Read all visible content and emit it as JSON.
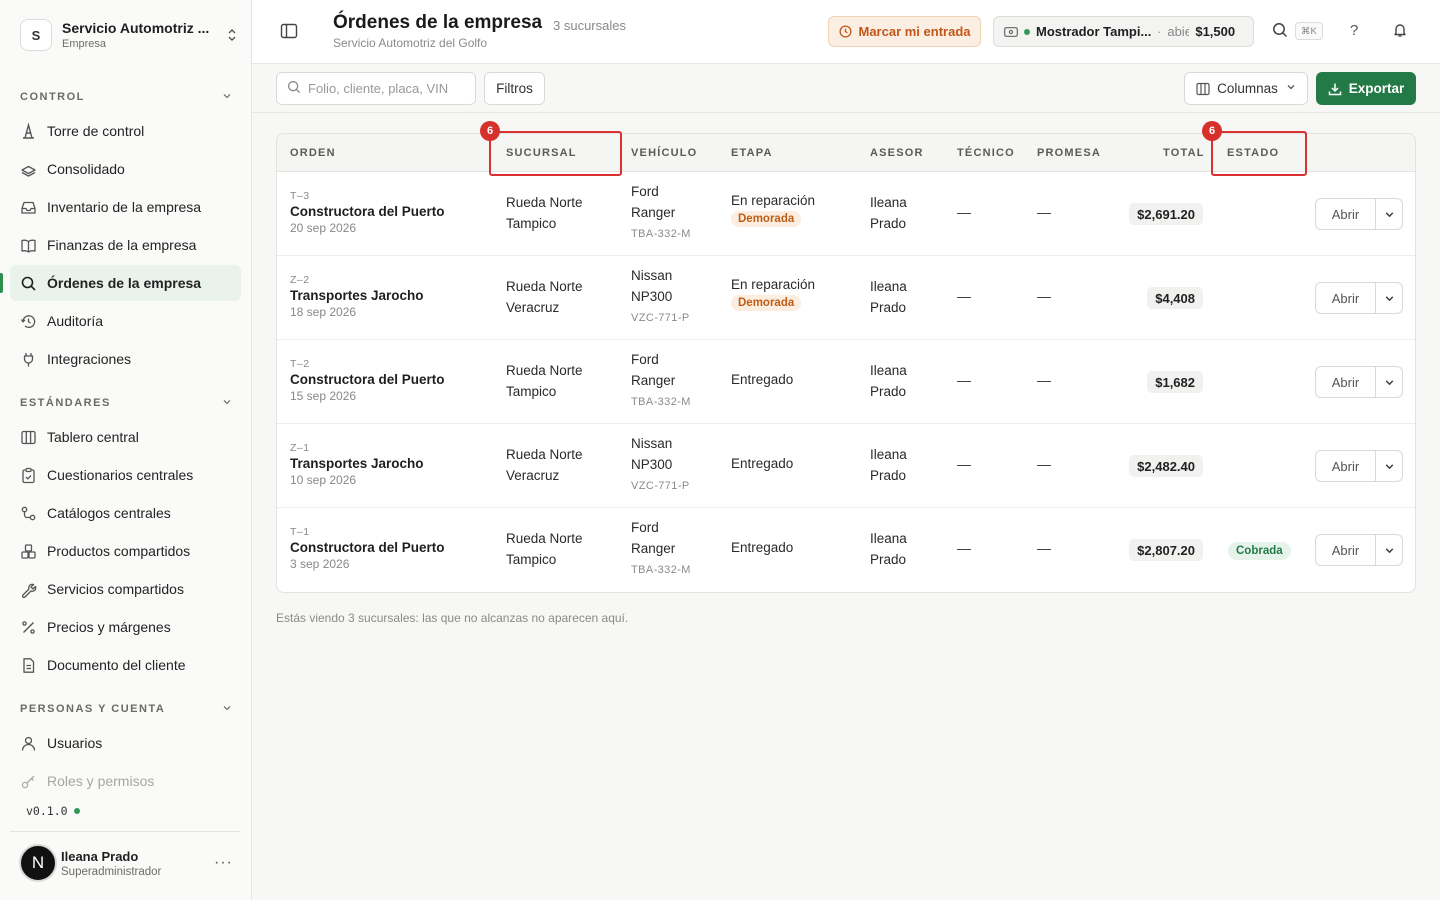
{
  "org": {
    "initial": "S",
    "name": "Servicio Automotriz ...",
    "type": "Empresa"
  },
  "sections": {
    "control": "CONTROL",
    "estandares": "ESTÁNDARES",
    "personas": "PERSONAS Y CUENTA"
  },
  "nav": {
    "control": [
      {
        "label": "Torre de control",
        "icon": "tower-icon"
      },
      {
        "label": "Consolidado",
        "icon": "stack-icon"
      },
      {
        "label": "Inventario de la empresa",
        "icon": "inbox-icon"
      },
      {
        "label": "Finanzas de la empresa",
        "icon": "book-icon"
      },
      {
        "label": "Órdenes de la empresa",
        "icon": "search-icon",
        "active": true
      },
      {
        "label": "Auditoría",
        "icon": "history-icon"
      },
      {
        "label": "Integraciones",
        "icon": "plug-icon"
      }
    ],
    "estandares": [
      {
        "label": "Tablero central",
        "icon": "columns-icon"
      },
      {
        "label": "Cuestionarios centrales",
        "icon": "clipboard-icon"
      },
      {
        "label": "Catálogos centrales",
        "icon": "catalog-icon"
      },
      {
        "label": "Productos compartidos",
        "icon": "boxes-icon"
      },
      {
        "label": "Servicios compartidos",
        "icon": "wrench-icon"
      },
      {
        "label": "Precios y márgenes",
        "icon": "percent-icon"
      },
      {
        "label": "Documento del cliente",
        "icon": "document-icon"
      }
    ],
    "personas": [
      {
        "label": "Usuarios",
        "icon": "user-icon"
      },
      {
        "label": "Roles y permisos",
        "icon": "key-icon"
      }
    ]
  },
  "version": "v0.1.0",
  "user": {
    "initial": "N",
    "name": "Ileana Prado",
    "role": "Superadministrador"
  },
  "header": {
    "title": "Órdenes de la empresa",
    "count": "3 sucursales",
    "subtitle": "Servicio Automotriz del Golfo",
    "checkin_label": "Marcar mi entrada",
    "register_name": "Mostrador Tampi...",
    "register_sep": "·",
    "register_state": "abierta",
    "register_amount": "$1,500",
    "shortcut": "⌘K",
    "help": "?"
  },
  "toolbar": {
    "search_placeholder": "Folio, cliente, placa, VIN",
    "filters_label": "Filtros",
    "columns_label": "Columnas",
    "export_label": "Exportar"
  },
  "table": {
    "headers": {
      "orden": "ORDEN",
      "sucursal": "SUCURSAL",
      "vehiculo": "VEHÍCULO",
      "etapa": "ETAPA",
      "asesor": "ASESOR",
      "tecnico": "TÉCNICO",
      "promesa": "PROMESA",
      "total": "TOTAL",
      "estado": "ESTADO"
    },
    "open_label": "Abrir",
    "rows": [
      {
        "folio": "T–3",
        "client": "Constructora del Puerto",
        "date": "20 sep 2026",
        "branch1": "Rueda Norte",
        "branch2": "Tampico",
        "make": "Ford",
        "model": "Ranger",
        "plate": "TBA-332-M",
        "stage": "En reparación",
        "flag": "Demorada",
        "adv1": "Ileana",
        "adv2": "Prado",
        "tech": "—",
        "promise": "—",
        "total": "$2,691.20",
        "status": ""
      },
      {
        "folio": "Z–2",
        "client": "Transportes Jarocho",
        "date": "18 sep 2026",
        "branch1": "Rueda Norte",
        "branch2": "Veracruz",
        "make": "Nissan",
        "model": "NP300",
        "plate": "VZC-771-P",
        "stage": "En reparación",
        "flag": "Demorada",
        "adv1": "Ileana",
        "adv2": "Prado",
        "tech": "—",
        "promise": "—",
        "total": "$4,408",
        "status": ""
      },
      {
        "folio": "T–2",
        "client": "Constructora del Puerto",
        "date": "15 sep 2026",
        "branch1": "Rueda Norte",
        "branch2": "Tampico",
        "make": "Ford",
        "model": "Ranger",
        "plate": "TBA-332-M",
        "stage": "Entregado",
        "flag": "",
        "adv1": "Ileana",
        "adv2": "Prado",
        "tech": "—",
        "promise": "—",
        "total": "$1,682",
        "status": ""
      },
      {
        "folio": "Z–1",
        "client": "Transportes Jarocho",
        "date": "10 sep 2026",
        "branch1": "Rueda Norte",
        "branch2": "Veracruz",
        "make": "Nissan",
        "model": "NP300",
        "plate": "VZC-771-P",
        "stage": "Entregado",
        "flag": "",
        "adv1": "Ileana",
        "adv2": "Prado",
        "tech": "—",
        "promise": "—",
        "total": "$2,482.40",
        "status": ""
      },
      {
        "folio": "T–1",
        "client": "Constructora del Puerto",
        "date": "3 sep 2026",
        "branch1": "Rueda Norte",
        "branch2": "Tampico",
        "make": "Ford",
        "model": "Ranger",
        "plate": "TBA-332-M",
        "stage": "Entregado",
        "flag": "",
        "adv1": "Ileana",
        "adv2": "Prado",
        "tech": "—",
        "promise": "—",
        "total": "$2,807.20",
        "status": "Cobrada"
      }
    ]
  },
  "footnote": "Estás viendo 3 sucursales: las que no alcanzas no aparecen aquí.",
  "annotations": {
    "sucursal_badge": "6",
    "estado_badge": "6"
  },
  "colors": {
    "accent": "#237a46",
    "warning": "#c2571a",
    "annotation": "#d93030"
  }
}
